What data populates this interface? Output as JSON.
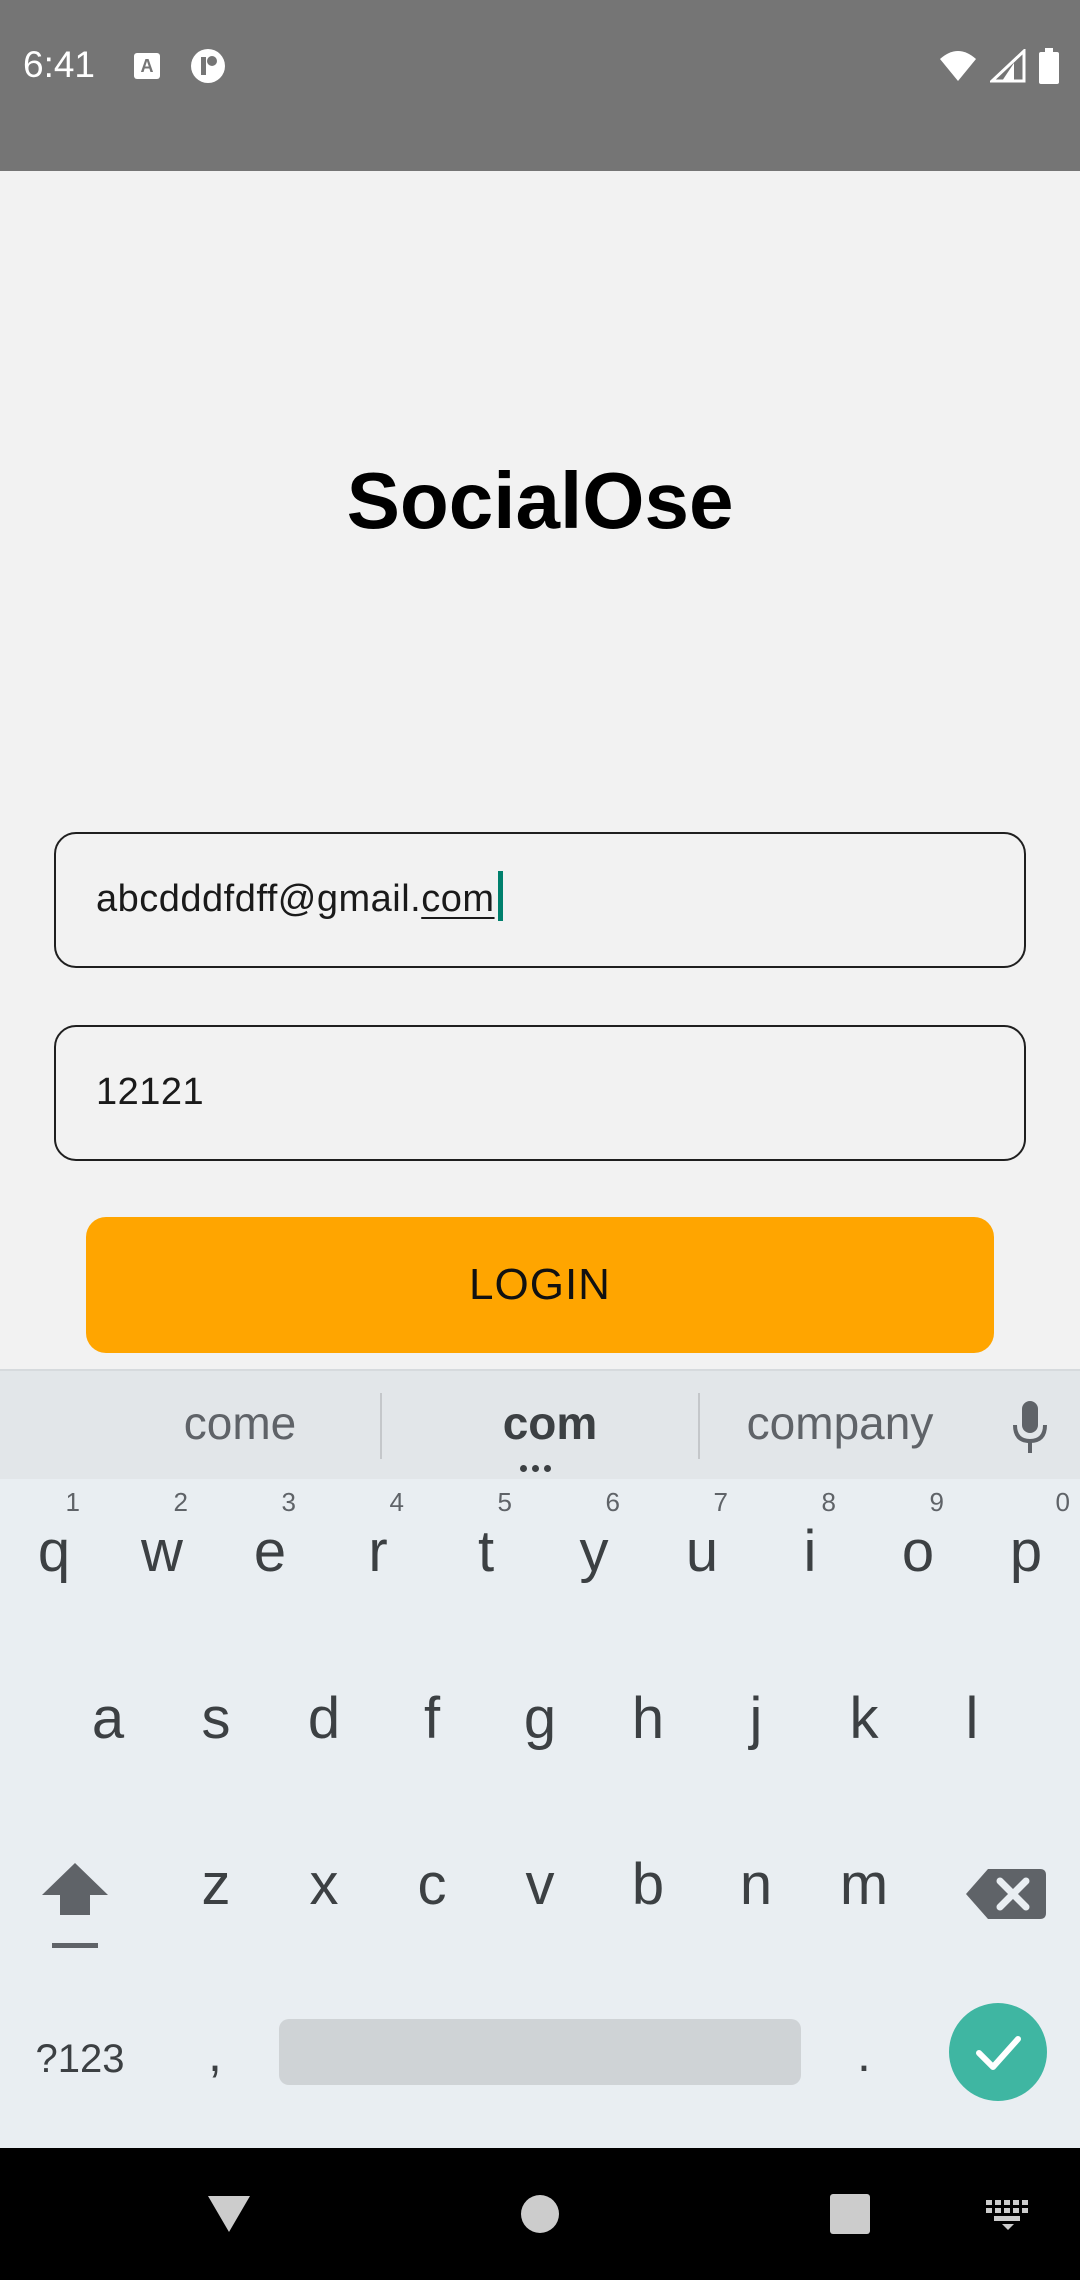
{
  "status_bar": {
    "time": "6:41",
    "notification_icons": [
      "keyboard-a-icon",
      "app-circle-icon"
    ],
    "system_icons": [
      "wifi-icon",
      "signal-icon",
      "battery-icon"
    ]
  },
  "app": {
    "title": "SocialOse",
    "email_value_prefix": "abcdddfdff@gmail.",
    "email_value_suffix": "com",
    "password_value": "12121",
    "login_label": "LOGIN",
    "accent_color": "#ffa500"
  },
  "keyboard": {
    "suggestions": [
      "come",
      "com",
      "company"
    ],
    "row1": [
      {
        "key": "q",
        "hint": "1"
      },
      {
        "key": "w",
        "hint": "2"
      },
      {
        "key": "e",
        "hint": "3"
      },
      {
        "key": "r",
        "hint": "4"
      },
      {
        "key": "t",
        "hint": "5"
      },
      {
        "key": "y",
        "hint": "6"
      },
      {
        "key": "u",
        "hint": "7"
      },
      {
        "key": "i",
        "hint": "8"
      },
      {
        "key": "o",
        "hint": "9"
      },
      {
        "key": "p",
        "hint": "0"
      }
    ],
    "row2": [
      "a",
      "s",
      "d",
      "f",
      "g",
      "h",
      "j",
      "k",
      "l"
    ],
    "row3": [
      "z",
      "x",
      "c",
      "v",
      "b",
      "n",
      "m"
    ],
    "symbols_label": "?123",
    "comma_label": ",",
    "period_label": ".",
    "enter_color": "#3fb6a2"
  },
  "nav_bar": {
    "buttons": [
      "back-icon",
      "home-icon",
      "recents-icon",
      "keyboard-switch-icon"
    ]
  }
}
